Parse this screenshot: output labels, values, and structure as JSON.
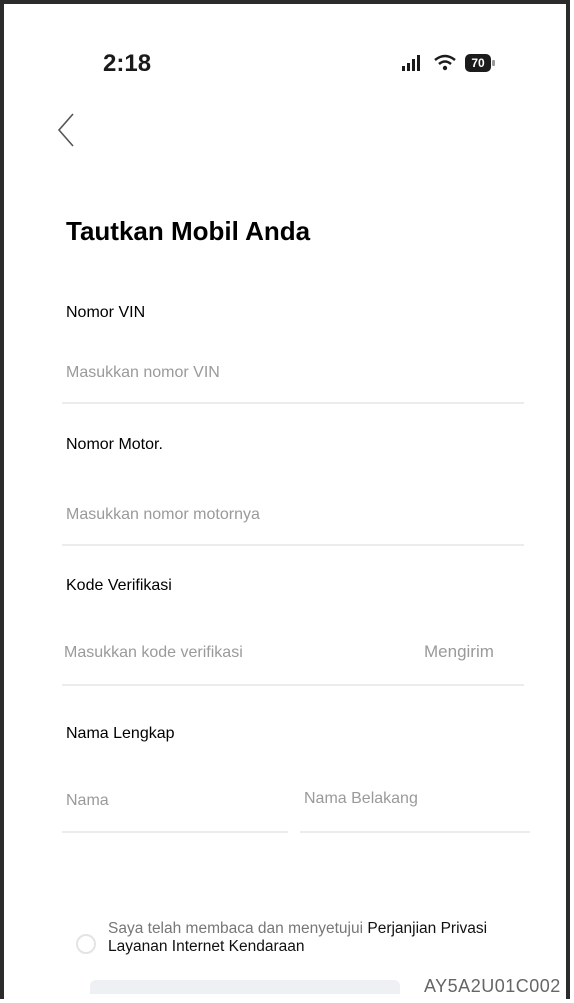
{
  "status_bar": {
    "time": "2:18",
    "battery": "70"
  },
  "title": "Tautkan Mobil Anda",
  "fields": {
    "vin": {
      "label": "Nomor VIN",
      "placeholder": "Masukkan nomor VIN"
    },
    "engine": {
      "label": "Nomor Motor.",
      "placeholder": "Masukkan nomor motornya"
    },
    "verification": {
      "label": "Kode Verifikasi",
      "placeholder": "Masukkan kode verifikasi",
      "send_label": "Mengirim"
    },
    "full_name": {
      "label": "Nama Lengkap",
      "first_placeholder": "Nama",
      "last_placeholder": "Nama Belakang"
    }
  },
  "agreement": {
    "text": "Saya telah membaca dan menyetujui ",
    "link_part1": "Perjanjian Privasi",
    "link_part2": "Layanan Internet Kendaraan"
  },
  "footer_code": "AY5A2U01C002",
  "colors": {
    "placeholder": "#9a9a9a",
    "divider": "#ececec",
    "text": "#000000"
  }
}
